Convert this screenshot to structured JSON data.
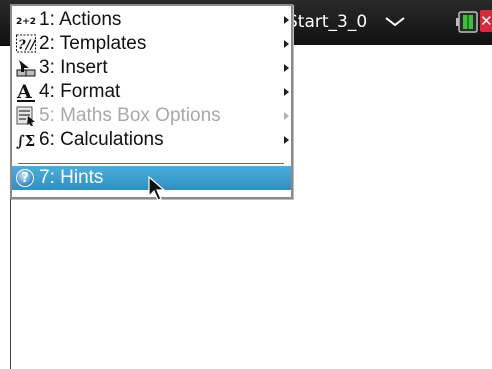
{
  "title_bar": {
    "document_title": "Start_3_0",
    "document_menu_icon": "chevron-down-icon",
    "battery_icon": "battery-icon",
    "close_icon": "close-icon"
  },
  "menu": {
    "items": [
      {
        "icon": "actions-icon",
        "icon_text": "2+2=",
        "label": "1: Actions",
        "submenu": true,
        "enabled": true
      },
      {
        "icon": "templates-icon",
        "icon_text": "?//",
        "label": "2: Templates",
        "submenu": true,
        "enabled": true
      },
      {
        "icon": "insert-icon",
        "icon_text": "",
        "label": "3: Insert",
        "submenu": true,
        "enabled": true
      },
      {
        "icon": "format-icon",
        "icon_text": "A",
        "label": "4: Format",
        "submenu": true,
        "enabled": true
      },
      {
        "icon": "maths-box-icon",
        "icon_text": "",
        "label": "5: Maths Box Options",
        "submenu": true,
        "enabled": false
      },
      {
        "icon": "calculations-icon",
        "icon_text": "∫Σ",
        "label": "6: Calculations",
        "submenu": true,
        "enabled": true
      },
      {
        "icon": "hints-icon",
        "icon_text": "?",
        "label": "7: Hints",
        "submenu": false,
        "enabled": true,
        "selected": true
      }
    ]
  },
  "colors": {
    "title_bar": "#1a1a1a",
    "selected_highlight": "#3b9ecf",
    "disabled_text": "#a8a8a8",
    "close_button": "#d62b3a",
    "battery_green": "#3fbf3f"
  }
}
